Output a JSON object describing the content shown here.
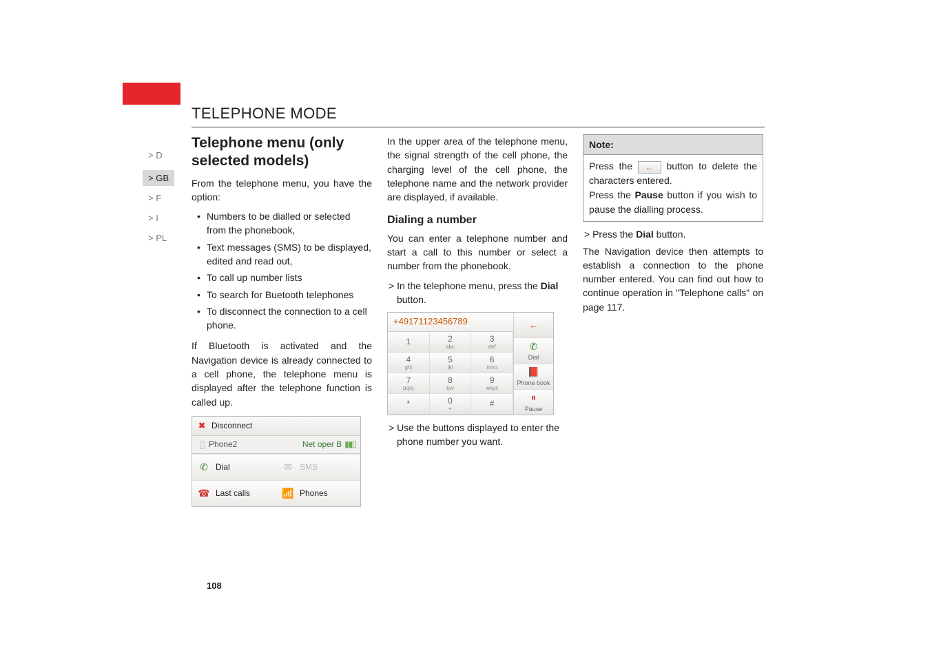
{
  "running_head_marker": ">>>",
  "running_head": "TELEPHONE MODE",
  "side_nav": [
    "> D",
    "> GB",
    "> F",
    "> I",
    "> PL"
  ],
  "side_nav_active_index": 1,
  "col1": {
    "section_title": "Telephone menu (only selected models)",
    "intro": "From the telephone menu, you have the option:",
    "bullets": [
      "Numbers to be dialled or    selected from the phonebook,",
      "Text messages (SMS) to be displayed, edited and read out,",
      "To call up number lists",
      "To search for Buetooth telephones",
      "To disconnect the connection to a cell phone."
    ],
    "para2": "If Bluetooth is activated and the Navigation device is already connected to a cell phone, the telephone menu is displayed after the telephone function is called up.",
    "shot1": {
      "disconnect": "Disconnect",
      "phone_label": "Phone2",
      "operator": "Net oper B",
      "btn_dial": "Dial",
      "btn_sms": "SMS",
      "btn_lastcalls": "Last calls",
      "btn_phones": "Phones"
    }
  },
  "col2": {
    "para1": "In the upper area of the telephone menu, the signal strength of the cell phone, the charging level of the cell phone, the telephone name and the network provider are displayed, if available.",
    "sub": "Dialing a number",
    "para2": "You can enter a telephone number and start a call to this number or select a number from the phonebook.",
    "step1_pre": "> In the telephone menu, press the ",
    "step1_bold": "Dial",
    "step1_post": " button.",
    "shot2": {
      "number": "+49171123456789",
      "keys": [
        {
          "n": "1",
          "l": ""
        },
        {
          "n": "2",
          "l": "abc"
        },
        {
          "n": "3",
          "l": "def"
        },
        {
          "n": "4",
          "l": "ghi"
        },
        {
          "n": "5",
          "l": "jkl"
        },
        {
          "n": "6",
          "l": "mno"
        },
        {
          "n": "7",
          "l": "pqrs"
        },
        {
          "n": "8",
          "l": "tuv"
        },
        {
          "n": "9",
          "l": "wxyz"
        },
        {
          "n": "*",
          "l": ""
        },
        {
          "n": "0",
          "l": "+"
        },
        {
          "n": "#",
          "l": ""
        }
      ],
      "r_back": "",
      "r_dial": "Dial",
      "r_book": "Phone book",
      "r_pause": "Pause"
    },
    "step2": "> Use the buttons displayed to enter the phone number you want."
  },
  "col3": {
    "note_title": "Note:",
    "note_l1a": "Press the ",
    "note_l1b": " button to delete the characters entered.",
    "note_l2a": "Press the ",
    "note_l2_bold": "Pause",
    "note_l2b": " button if you wish to pause the dialling process.",
    "step3_pre": "> Press the ",
    "step3_bold": "Dial",
    "step3_post": " button.",
    "para": "The Navigation device then attempts to establish a connection to the phone number entered. You can find out how to continue operation in \"Telephone calls\" on page 117."
  },
  "page_number": "108"
}
